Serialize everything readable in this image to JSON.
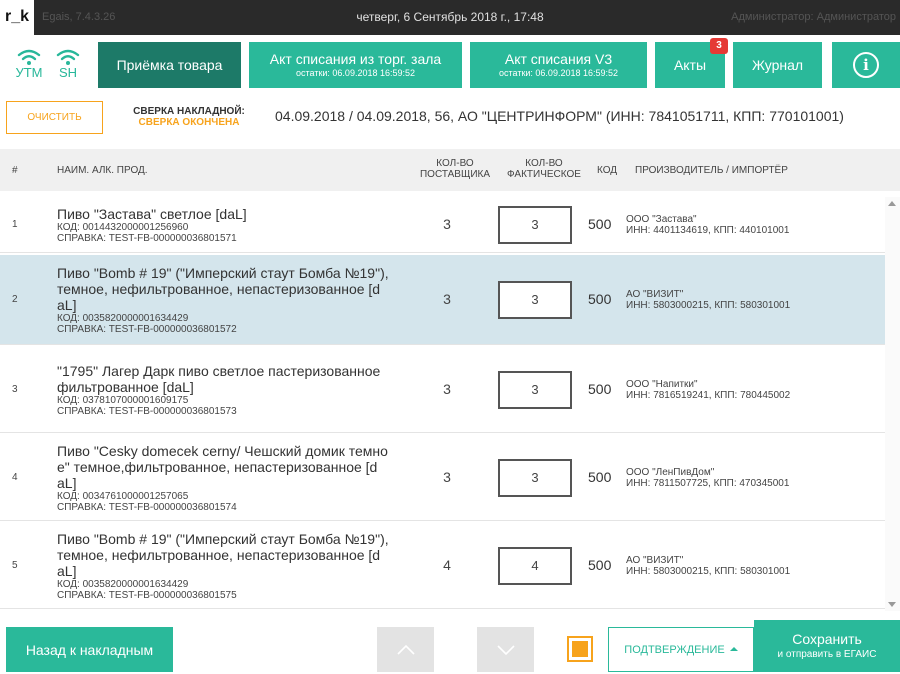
{
  "app": {
    "logo": "r_k",
    "version": "Egais, 7.4.3.26",
    "datetime": "четверг, 6 Сентябрь 2018 г., 17:48",
    "user": "Администратор: Администратор"
  },
  "status": {
    "utm": "УТМ",
    "sh": "SH",
    "color": "#28b79a"
  },
  "toolbar": {
    "receive": "Приёмка товара",
    "act_hall": "Акт списания из торг. зала",
    "act_hall_sub": "остатки: 06.09.2018 16:59:52",
    "act_v3": "Акт списания V3",
    "act_v3_sub": "остатки: 06.09.2018 16:59:52",
    "acts": "Акты",
    "acts_badge": "3",
    "journal": "Журнал",
    "info": "i"
  },
  "recon": {
    "clear": "ОЧИСТИТЬ",
    "title": "СВЕРКА НАКЛАДНОЙ:",
    "status": "СВЕРКА ОКОНЧЕНА",
    "info": "04.09.2018 / 04.09.2018, 56, АО \"ЦЕНТРИНФОРМ\" (ИНН: 7841051711, КПП: 770101001)"
  },
  "table": {
    "headers": {
      "num": "#",
      "name": "НАИМ. АЛК. ПРОД.",
      "qty_supplier": "КОЛ-ВО ПОСТАВЩИКА",
      "qty_actual": "КОЛ-ВО ФАКТИЧЕСКОЕ",
      "code": "КОД",
      "manufacturer": "ПРОИЗВОДИТЕЛЬ / ИМПОРТЁР"
    },
    "rows": [
      {
        "num": "1",
        "name_lines": [
          "Пиво \"Застава\" светлое  [daL]"
        ],
        "code": "КОД: 0014432000001256960",
        "ref": "СПРАВКА: TEST-FB-000000036801571",
        "qty_supplier": "3",
        "qty_actual": "3",
        "type_code": "500",
        "mfr_name": "ООО \"Застава\"",
        "mfr_inn": "ИНН: 4401134619, КПП: 440101001"
      },
      {
        "num": "2",
        "name_lines": [
          "Пиво \"Bomb # 19\" (\"Имперский стаут Бомба №19\"),",
          "темное, нефильтрованное, непастеризованное  [d",
          "aL]"
        ],
        "code": "КОД: 0035820000001634429",
        "ref": "СПРАВКА: TEST-FB-000000036801572",
        "qty_supplier": "3",
        "qty_actual": "3",
        "type_code": "500",
        "mfr_name": "АО \"ВИЗИТ\"",
        "mfr_inn": "ИНН: 5803000215, КПП: 580301001"
      },
      {
        "num": "3",
        "name_lines": [
          "\"1795\" Лагер Дарк пиво светлое пастеризованное",
          "фильтрованное  [daL]"
        ],
        "code": "КОД: 0378107000001609175",
        "ref": "СПРАВКА: TEST-FB-000000036801573",
        "qty_supplier": "3",
        "qty_actual": "3",
        "type_code": "500",
        "mfr_name": "ООО \"Напитки\"",
        "mfr_inn": "ИНН: 7816519241, КПП: 780445002"
      },
      {
        "num": "4",
        "name_lines": [
          "Пиво \"Cesky domecek cerny/ Чешский домик темно",
          "е\" темное,фильтрованное, непастеризованное  [d",
          "aL]"
        ],
        "code": "КОД: 0034761000001257065",
        "ref": "СПРАВКА: TEST-FB-000000036801574",
        "qty_supplier": "3",
        "qty_actual": "3",
        "type_code": "500",
        "mfr_name": "ООО \"ЛенПивДом\"",
        "mfr_inn": "ИНН: 7811507725, КПП: 470345001"
      },
      {
        "num": "5",
        "name_lines": [
          "Пиво \"Bomb # 19\" (\"Имперский стаут Бомба №19\"),",
          "темное, нефильтрованное, непастеризованное  [d",
          "aL]"
        ],
        "code": "КОД: 0035820000001634429",
        "ref": "СПРАВКА: TEST-FB-000000036801575",
        "qty_supplier": "4",
        "qty_actual": "4",
        "type_code": "500",
        "mfr_name": "АО \"ВИЗИТ\"",
        "mfr_inn": "ИНН: 5803000215, КПП: 580301001"
      }
    ],
    "selected_row": 2
  },
  "footer": {
    "back": "Назад к накладным",
    "confirm": "ПОДТВЕРЖДЕНИЕ",
    "save": "Сохранить",
    "save_sub": "и отправить в ЕГАИС",
    "checkbox_checked": true
  },
  "colors": {
    "accent": "#2ab99a",
    "accent_dark": "#1d7a68",
    "orange": "#f7a31c",
    "selected_row": "#d4e5ec",
    "badge": "#e53935"
  }
}
